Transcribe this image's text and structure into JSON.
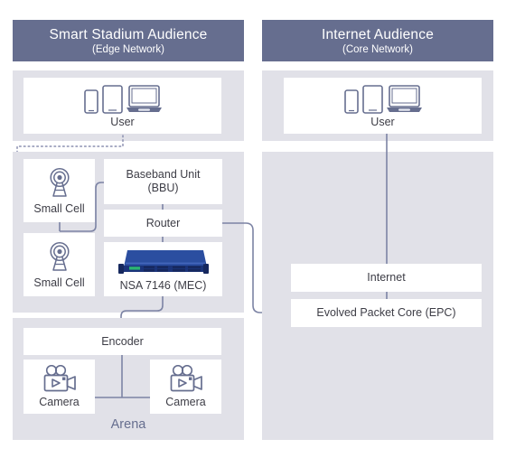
{
  "columns": [
    {
      "id": "edge",
      "header": {
        "title": "Smart Stadium Audience",
        "subtitle": "(Edge Network)"
      }
    },
    {
      "id": "core",
      "header": {
        "title": "Internet Audience",
        "subtitle": "(Core Network)"
      }
    }
  ],
  "edge": {
    "user_box": {
      "label": "User",
      "icon": "user-devices-icon"
    },
    "small_cell_top": {
      "label": "Small Cell",
      "icon": "antenna-tower-icon"
    },
    "small_cell_bottom": {
      "label": "Small Cell",
      "icon": "antenna-tower-icon"
    },
    "bbu": {
      "label_line1": "Baseband Unit",
      "label_line2": "(BBU)"
    },
    "router": {
      "label": "Router"
    },
    "mec": {
      "label": "NSA 7146 (MEC)",
      "icon": "rack-server-icon"
    },
    "encoder": {
      "label": "Encoder"
    },
    "camera_left": {
      "label": "Camera",
      "icon": "video-camera-icon"
    },
    "camera_right": {
      "label": "Camera",
      "icon": "video-camera-icon"
    },
    "arena_caption": "Arena"
  },
  "core": {
    "user_box": {
      "label": "User",
      "icon": "user-devices-icon"
    },
    "internet": {
      "label": "Internet"
    },
    "epc": {
      "label": "Evolved Packet Core (EPC)"
    }
  },
  "colors": {
    "header_bg": "#666e8f",
    "panel_bg": "#e1e1e8",
    "node_bg": "#ffffff",
    "connector": "#7c83a4",
    "icon_stroke": "#666e8f",
    "server_blue": "#1f3c88",
    "text": "#3d3d46",
    "arena_text": "#666e8f"
  }
}
